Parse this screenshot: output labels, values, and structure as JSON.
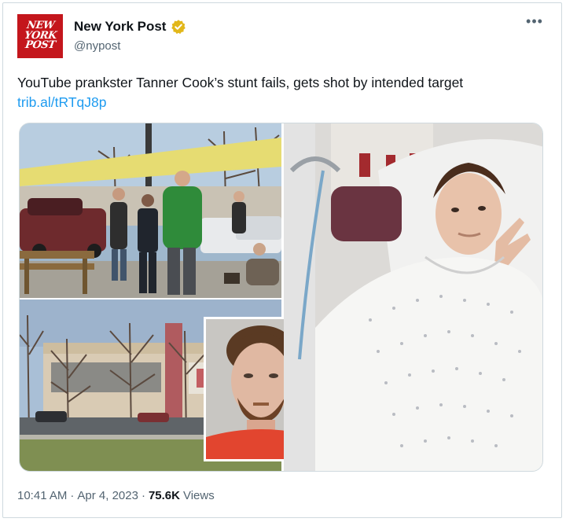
{
  "account": {
    "logo_lines": [
      "NEW",
      "YORK",
      "POST"
    ],
    "name": "New York Post",
    "handle": "@nypost",
    "verified_icon": "verified-gold-badge-icon"
  },
  "more_icon": "more-dots-icon",
  "tweet": {
    "text": "YouTube prankster Tanner Cook’s stunt fails, gets shot by intended target ",
    "link": "trib.al/tRTqJ8p"
  },
  "media": {
    "images": [
      "crime-scene-photo",
      "building-exterior-photo",
      "mugshot-photo",
      "hospital-selfie-photo"
    ]
  },
  "meta": {
    "time": "10:41 AM",
    "sep1": "·",
    "date": "Apr 4, 2023",
    "sep2": "·",
    "views_count": "75.6K",
    "views_label": "Views"
  },
  "colors": {
    "brand_red": "#c4161c",
    "link_blue": "#1d9bf0",
    "secondary_text": "#536471",
    "verified_gold": "#e2b719"
  }
}
